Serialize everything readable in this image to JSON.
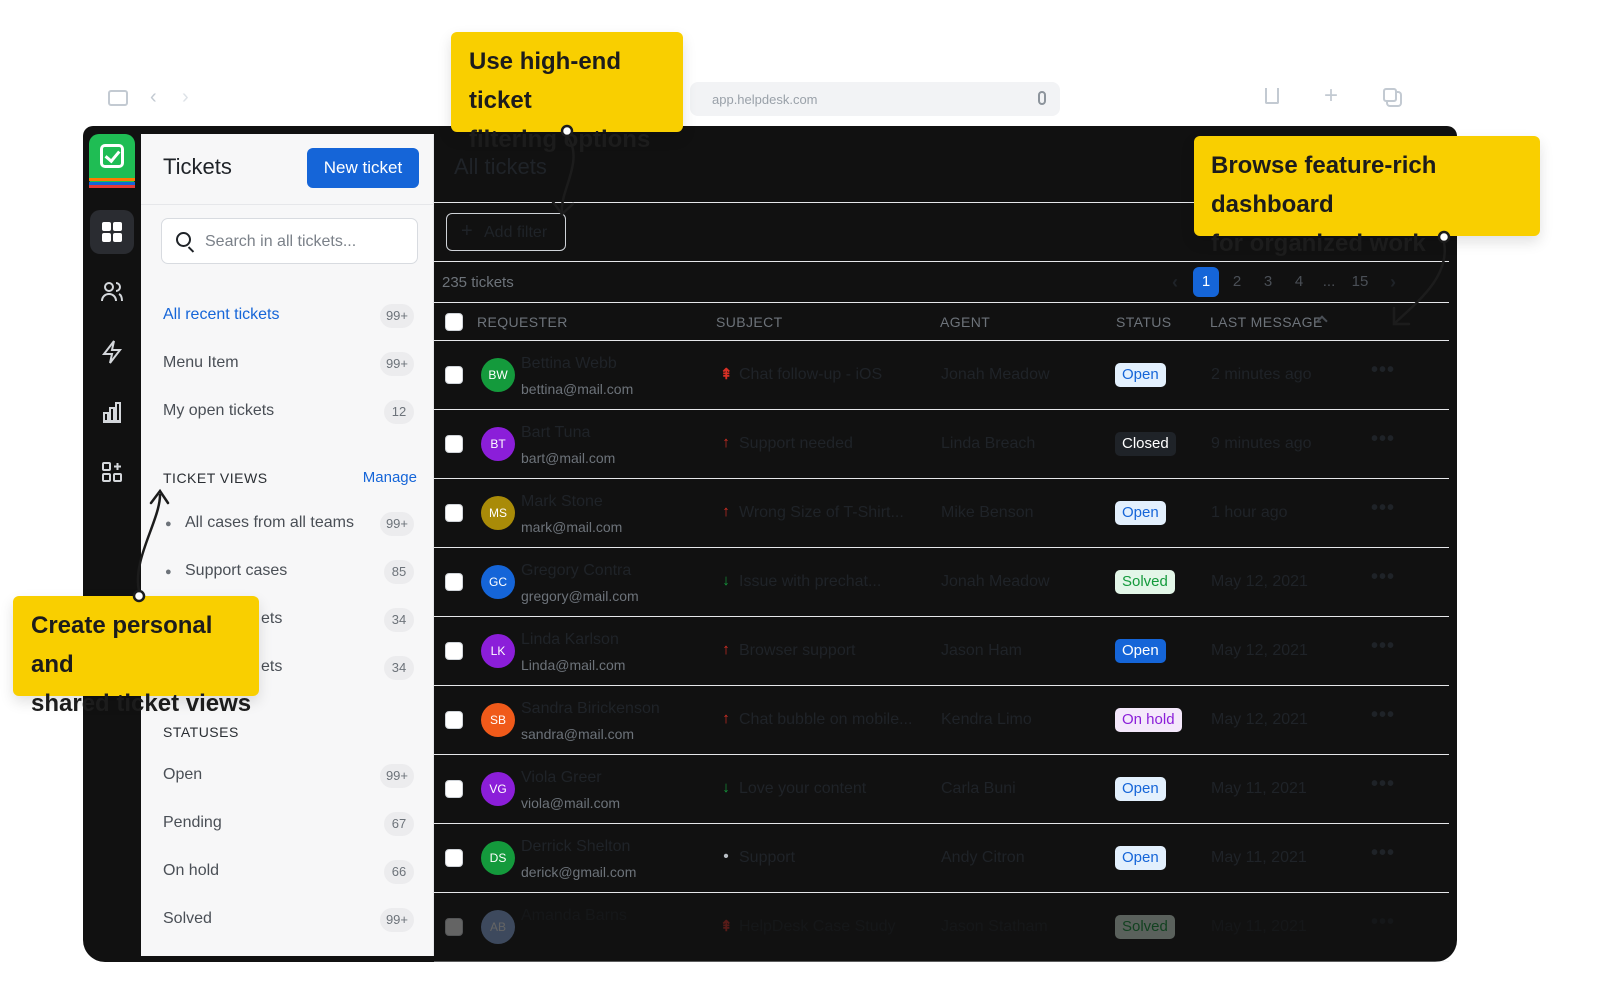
{
  "browser": {
    "url": "app.helpdesk.com"
  },
  "sidebar": {
    "title": "Tickets",
    "new_ticket_label": "New ticket",
    "search_placeholder": "Search in all tickets...",
    "items": [
      {
        "label": "All recent tickets",
        "count": "99+"
      },
      {
        "label": "Menu Item",
        "count": "99+"
      },
      {
        "label": "My open tickets",
        "count": "12"
      }
    ],
    "views_heading": "TICKET VIEWS",
    "manage_label": "Manage",
    "views": [
      {
        "label": "All cases from all teams",
        "count": "99+"
      },
      {
        "label": "Support cases",
        "count": "85"
      },
      {
        "label": "ets",
        "count": "34"
      },
      {
        "label": "ets",
        "count": "34"
      }
    ],
    "statuses_heading": "STATUSES",
    "statuses": [
      {
        "label": "Open",
        "count": "99+"
      },
      {
        "label": "Pending",
        "count": "67"
      },
      {
        "label": "On hold",
        "count": "66"
      },
      {
        "label": "Solved",
        "count": "99+"
      }
    ]
  },
  "main": {
    "title": "All tickets",
    "add_filter_label": "Add filter",
    "ticket_count": "235 tickets",
    "pagination": {
      "pages": [
        "1",
        "2",
        "3",
        "4",
        "...",
        "15"
      ],
      "current": "1"
    },
    "columns": [
      "REQUESTER",
      "SUBJECT",
      "AGENT",
      "STATUS",
      "LAST MESSAGE"
    ],
    "rows": [
      {
        "initials": "BW",
        "name": "Bettina Webb",
        "email": "bettina@mail.com",
        "priority": "urgent",
        "subject": "Chat follow-up - iOS",
        "agent": "Jonah Meadow",
        "status": "Open",
        "last": "2 minutes ago"
      },
      {
        "initials": "BT",
        "name": "Bart Tuna",
        "email": "bart@mail.com",
        "priority": "high",
        "subject": "Support needed",
        "agent": "Linda Breach",
        "status": "Closed",
        "last": "9 minutes ago"
      },
      {
        "initials": "MS",
        "name": "Mark Stone",
        "email": "mark@mail.com",
        "priority": "high",
        "subject": "Wrong Size of T-Shirt...",
        "agent": "Mike Benson",
        "status": "Open",
        "last": "1 hour ago"
      },
      {
        "initials": "GC",
        "name": "Gregory Contra",
        "email": "gregory@mail.com",
        "priority": "low",
        "subject": "Issue with prechat...",
        "agent": "Jonah Meadow",
        "status": "Solved",
        "last": "May 12, 2021"
      },
      {
        "initials": "LK",
        "name": "Linda Karlson",
        "email": "Linda@mail.com",
        "priority": "high",
        "subject": "Browser support",
        "agent": "Jason Ham",
        "status": "Open",
        "last": "May 12, 2021"
      },
      {
        "initials": "SB",
        "name": "Sandra Birickenson",
        "email": "sandra@mail.com",
        "priority": "high",
        "subject": "Chat bubble on mobile...",
        "agent": "Kendra Limo",
        "status": "On hold",
        "last": "May 12, 2021"
      },
      {
        "initials": "VG",
        "name": "Viola Greer",
        "email": "viola@mail.com",
        "priority": "low",
        "subject": "Love your content",
        "agent": "Carla Buni",
        "status": "Open",
        "last": "May 11, 2021"
      },
      {
        "initials": "DS",
        "name": "Derrick Shelton",
        "email": "derick@gmail.com",
        "priority": "normal",
        "subject": "Support",
        "agent": "Andy Citron",
        "status": "Open",
        "last": "May 11, 2021"
      },
      {
        "initials": "AB",
        "name": "Amanda Barns",
        "email": "",
        "priority": "urgent",
        "subject": "HelpDesk Case Study",
        "agent": "Jason Statham",
        "status": "Solved",
        "last": "May 11, 2021"
      }
    ]
  },
  "callouts": {
    "filtering": [
      "Use high-end ticket",
      "filtering options"
    ],
    "dashboard": [
      "Browse feature-rich dashboard",
      "for organized work"
    ],
    "views": [
      "Create personal and",
      "shared ticket views"
    ]
  },
  "colors": {
    "accent": "#1565d8",
    "logo_green": "#1fbd54",
    "callout_yellow": "#f9cf00"
  },
  "icons": {
    "rail": [
      "dashboard-icon",
      "people-icon",
      "lightning-icon",
      "reports-icon",
      "apps-icon"
    ]
  }
}
